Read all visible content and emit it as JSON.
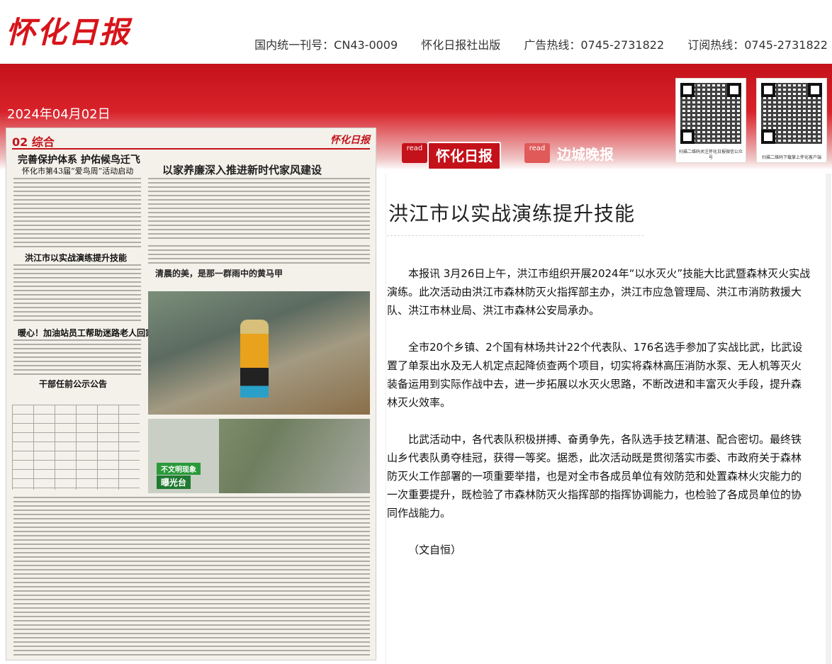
{
  "header": {
    "logo": "怀化日报",
    "issn": "国内统一刊号：CN43-0009",
    "publisher": "怀化日报社出版",
    "ad_hotline": "广告热线：0745-2731822",
    "subscribe_hotline": "订阅热线：0745-2731822"
  },
  "date": "2024年04月02日",
  "qr_codes": [
    {
      "caption": "扫描二维码关注怀化日报微信公众号"
    },
    {
      "caption": "扫描二维码下载掌上怀化客户端"
    }
  ],
  "papers": [
    {
      "read": "read",
      "name": "怀化日报"
    },
    {
      "read": "read",
      "name": "边城晚报"
    }
  ],
  "page_thumb": {
    "section": "02 综合",
    "logo": "怀化日报",
    "headline1": "完善保护体系  护佑候鸟迁飞",
    "headline1_sub": "怀化市第43届“爱鸟周”活动启动",
    "big_title": "以家养廉深入推进新时代家风建设",
    "headline2": "洪江市以实战演练提升技能",
    "headline3": "暖心！加油站员工帮助迷路老人回家",
    "headline4": "干部任前公示公告",
    "photo_caption": "清晨的美，是那一群雨中的黄马甲",
    "photo_tag": "不文明现象",
    "photo_tag2": "曝光台"
  },
  "article": {
    "title": "洪江市以实战演练提升技能",
    "paragraphs": [
      "本报讯 3月26日上午，洪江市组织开展2024年“以水灭火”技能大比武暨森林灭火实战演练。此次活动由洪江市森林防灭火指挥部主办，洪江市应急管理局、洪江市消防救援大队、洪江市林业局、洪江市森林公安局承办。",
      "全市20个乡镇、2个国有林场共计22个代表队、176名选手参加了实战比武，比武设置了单泵出水及无人机定点起降侦查两个项目，切实将森林高压消防水泵、无人机等灭火装备运用到实际作战中去，进一步拓展以水灭火思路，不断改进和丰富灭火手段，提升森林灭火效率。",
      "比武活动中，各代表队积极拼搏、奋勇争先，各队选手技艺精湛、配合密切。最终铁山乡代表队勇夺桂冠，获得一等奖。据悉，此次活动既是贯彻落实市委、市政府关于森林防灭火工作部署的一项重要举措，也是对全市各成员单位有效防范和处置森林火灾能力的一次重要提升，既检验了市森林防灭火指挥部的指挥协调能力，也检验了各成员单位的协同作战能力。",
      "（文自恒）"
    ]
  }
}
